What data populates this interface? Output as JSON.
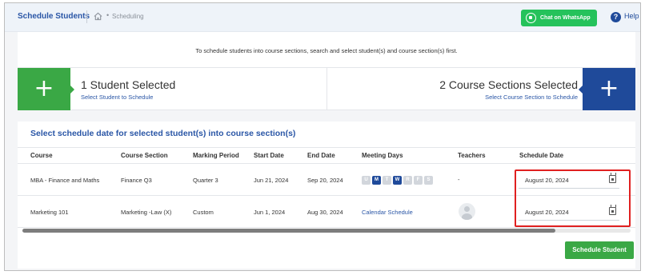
{
  "topbar": {
    "title": "Schedule Students",
    "crumb_separator": "•",
    "crumb": "Scheduling",
    "whatsapp_label": "Chat on WhatsApp",
    "help_icon_glyph": "?",
    "help_label": "Help"
  },
  "instruction": "To schedule students into course sections, search and select student(s) and course section(s) first.",
  "selection": {
    "plus_glyph": "+",
    "students_count_label": "1 Student Selected",
    "students_link": "Select Student to Schedule",
    "courses_count_label": "2 Course Sections Selected",
    "courses_link": "Select Course Section to Schedule"
  },
  "section_title": "Select schedule date for selected student(s) into course section(s)",
  "table": {
    "headers": {
      "course": "Course",
      "section": "Course Section",
      "period": "Marking Period",
      "start": "Start Date",
      "end": "End Date",
      "days": "Meeting Days",
      "teachers": "Teachers",
      "schedule": "Schedule Date"
    },
    "rows": [
      {
        "course": "MBA - Finance and Maths",
        "section": "Finance Q3",
        "period": "Quarter 3",
        "start": "Jun 21, 2024",
        "end": "Sep 20, 2024",
        "days": [
          {
            "label": "U",
            "on": false
          },
          {
            "label": "M",
            "on": true
          },
          {
            "label": "T",
            "on": false
          },
          {
            "label": "W",
            "on": true
          },
          {
            "label": "R",
            "on": false
          },
          {
            "label": "F",
            "on": false
          },
          {
            "label": "S",
            "on": false
          }
        ],
        "teachers": "-",
        "schedule_date": "August 20, 2024"
      },
      {
        "course": "Marketing 101",
        "section": "Marketing -Law (X)",
        "period": "Custom",
        "start": "Jun 1, 2024",
        "end": "Aug 30, 2024",
        "days_link": "Calendar Schedule",
        "schedule_date": "August 20, 2024"
      }
    ]
  },
  "schedule_button": "Schedule Student",
  "colors": {
    "primary_blue": "#1f4a9a",
    "green": "#3aa845",
    "whatsapp_green": "#25c25b",
    "highlight_red": "#e02020"
  }
}
